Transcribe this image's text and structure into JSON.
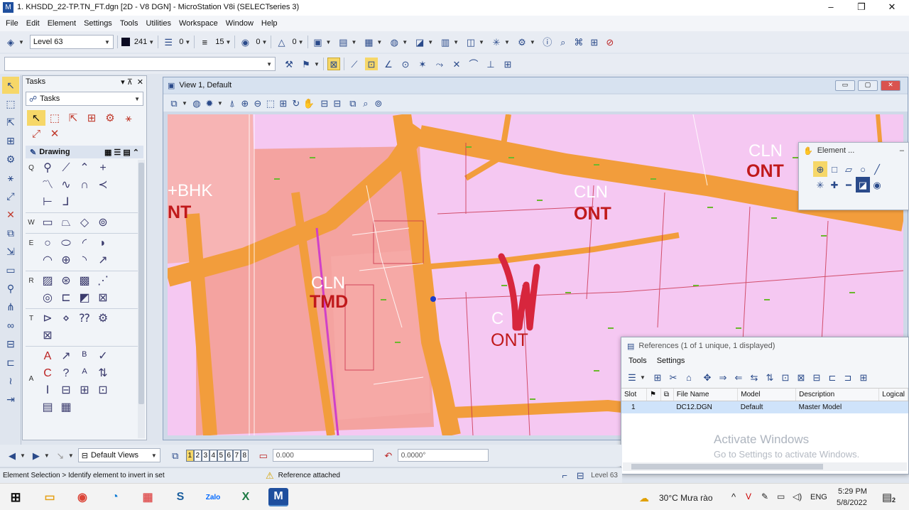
{
  "window": {
    "title": "1. KHSDD_22-TP.TN_FT.dgn [2D - V8 DGN] - MicroStation V8i (SELECTseries 3)",
    "min": "–",
    "max": "❐",
    "close": "✕"
  },
  "menu": {
    "items": [
      "File",
      "Edit",
      "Element",
      "Settings",
      "Tools",
      "Utilities",
      "Workspace",
      "Window",
      "Help"
    ]
  },
  "toolbar1": {
    "level": "Level 63",
    "color": "241",
    "color_swatch": "#0a0a22",
    "linestyle": "0",
    "weight": "15",
    "transparency": "0",
    "priority": "0"
  },
  "tasks": {
    "panel_title": "Tasks",
    "pin": "▾ ⊼",
    "close": "✕",
    "dropdown_label": "Tasks",
    "drawing_label": "Drawing",
    "row_keys": [
      "Q",
      "W",
      "E",
      "R",
      "T",
      "A"
    ]
  },
  "view": {
    "title": "View 1, Default",
    "map_labels": [
      {
        "text": "CLN",
        "color": "white"
      },
      {
        "text": "ONT",
        "color": "red"
      },
      {
        "text": "+BHK",
        "color": "white"
      },
      {
        "text": "NT",
        "color": "red"
      },
      {
        "text": "CLN",
        "color": "white"
      },
      {
        "text": "ONT",
        "color": "red"
      },
      {
        "text": "CLN",
        "color": "white"
      },
      {
        "text": "TMD",
        "color": "red"
      },
      {
        "text": "C",
        "color": "white"
      },
      {
        "text": "ONT",
        "color": "red"
      }
    ]
  },
  "element_panel": {
    "title": "Element ...",
    "min": "–"
  },
  "references": {
    "title": "References (1 of 1 unique, 1 displayed)",
    "menu": [
      "Tools",
      "Settings"
    ],
    "columns": [
      "Slot",
      "",
      "",
      "File Name",
      "Model",
      "Description",
      "Logical"
    ],
    "rows": [
      {
        "slot": "1",
        "file": "DC12.DGN",
        "model": "Default",
        "description": "Master Model",
        "logical": ""
      }
    ],
    "watermark_title": "Activate Windows",
    "watermark_sub": "Go to Settings to activate Windows."
  },
  "view_controls": {
    "views_label": "Default Views",
    "view_numbers": [
      "1",
      "2",
      "3",
      "4",
      "5",
      "6",
      "7",
      "8"
    ],
    "active_view": "1",
    "distance": "0.000",
    "angle": "0.0000°"
  },
  "status": {
    "prompt": "Element Selection > Identify element to invert in set",
    "message": "Reference attached",
    "level_hint": "Level 63"
  },
  "taskbar": {
    "weather": "30°C  Mưa rào",
    "lang": "ENG",
    "time": "5:29 PM",
    "date": "5/8/2022",
    "notif_count": "2"
  }
}
